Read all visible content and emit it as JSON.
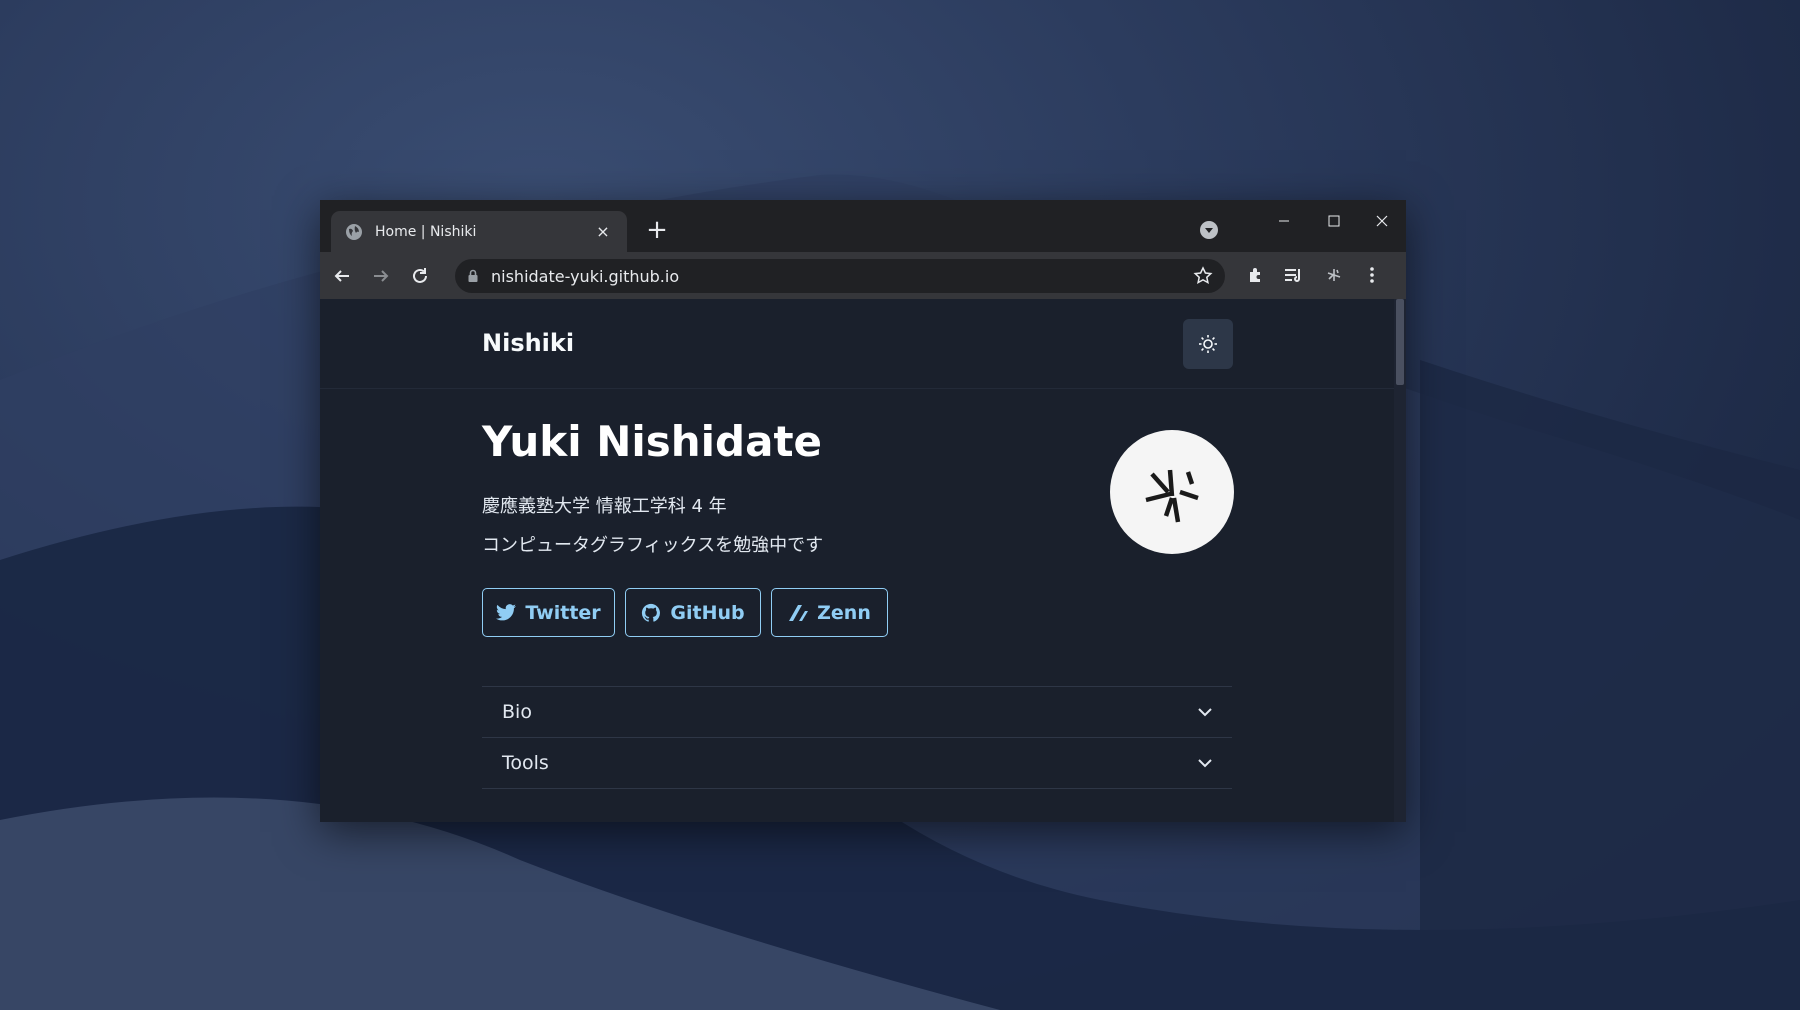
{
  "browser": {
    "tab": {
      "title": "Home | Nishiki",
      "favicon": "globe-icon",
      "close": "×"
    },
    "new_tab": "+",
    "address": {
      "url": "nishidate-yuki.github.io"
    }
  },
  "site": {
    "brand": "Nishiki",
    "theme_toggle_icon": "sun-icon"
  },
  "profile": {
    "name": "Yuki Nishidate",
    "affiliation": "慶應義塾大学 情報工学科 4 年",
    "description": "コンピュータグラフィックスを勉強中です",
    "links": [
      {
        "label": "Twitter",
        "icon": "twitter-icon"
      },
      {
        "label": "GitHub",
        "icon": "github-icon"
      },
      {
        "label": "Zenn",
        "icon": "zenn-icon"
      }
    ]
  },
  "accordion": [
    {
      "label": "Bio"
    },
    {
      "label": "Tools"
    }
  ],
  "colors": {
    "page_bg": "#1a202c",
    "accent": "#90cdf4",
    "tabstrip": "#202124",
    "toolbar": "#35363a"
  }
}
